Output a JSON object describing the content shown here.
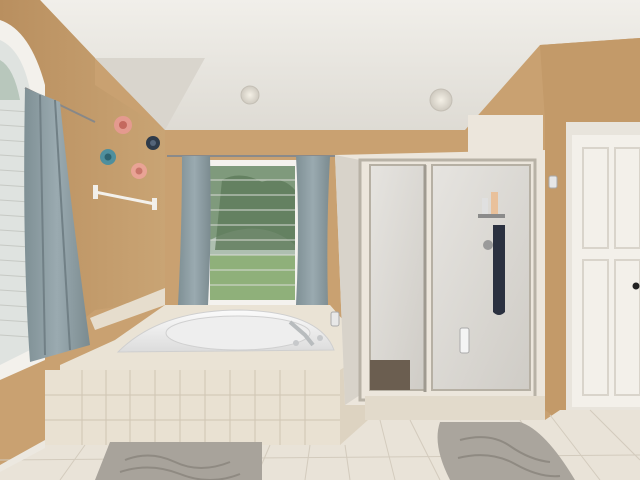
{
  "scene": {
    "kind": "bathroom-interior-photo",
    "colors": {
      "wall": "#c9a171",
      "wall_shadow": "#b88d5d",
      "ceiling": "#e9e7e2",
      "tile": "#e9e1d2",
      "tile_grout": "#cfc5b3",
      "curtain": "#8e9ea3",
      "door": "#f2efe9",
      "glass": "#dcdad6",
      "frame": "#b8b2a6",
      "rug": "#a9a39b"
    },
    "elements": [
      "textured-ceiling",
      "left-window-with-blinds",
      "grey-curtain-left",
      "wall-flower-decor",
      "towel-bar",
      "center-window",
      "grey-curtains-center",
      "corner-jetted-tub",
      "tiled-tub-surround",
      "walk-in-glass-shower",
      "shower-caddy",
      "hanging-towel",
      "white-paneled-door",
      "tile-floor",
      "bath-rugs"
    ]
  }
}
